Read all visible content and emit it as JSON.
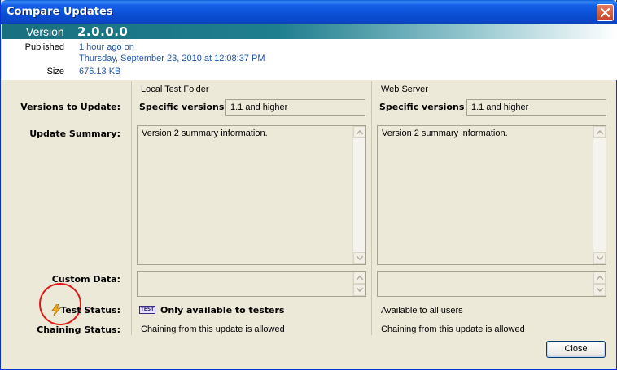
{
  "window": {
    "title": "Compare Updates"
  },
  "version": {
    "label": "Version",
    "value": "2.0.0.0"
  },
  "info": {
    "published_label": "Published",
    "published_relative": "1 hour ago on",
    "published_date": "Thursday, September 23, 2010 at 12:08:37 PM",
    "size_label": "Size",
    "size_value": "676.13 KB"
  },
  "columns": {
    "left_header": "Local Test Folder",
    "right_header": "Web Server"
  },
  "rows": {
    "versions_label": "Versions to Update:",
    "summary_label": "Update Summary:",
    "custom_label": "Custom Data:",
    "test_label": "Test Status:",
    "chaining_label": "Chaining Status:"
  },
  "left": {
    "versions_mode": "Specific versions",
    "versions_value": "1.1 and higher",
    "summary": "Version 2 summary information.",
    "custom": "",
    "test_badge": "TEST",
    "test_status": "Only available to testers",
    "chaining": "Chaining from this update is allowed"
  },
  "right": {
    "versions_mode": "Specific versions",
    "versions_value": "1.1 and higher",
    "summary": "Version 2 summary information.",
    "custom": "",
    "test_status": "Available to all users",
    "chaining": "Chaining from this update is allowed"
  },
  "buttons": {
    "close_label": "Close"
  },
  "icons": {
    "close": "close-icon",
    "test_status": "lightning-icon",
    "scroll_up": "chevron-up-icon",
    "scroll_down": "chevron-down-icon"
  },
  "colors": {
    "title_bar": "#0a4fd4",
    "version_banner": "#1f7e8e",
    "link_text": "#2055a8",
    "annotation_circle": "#e0191a"
  }
}
